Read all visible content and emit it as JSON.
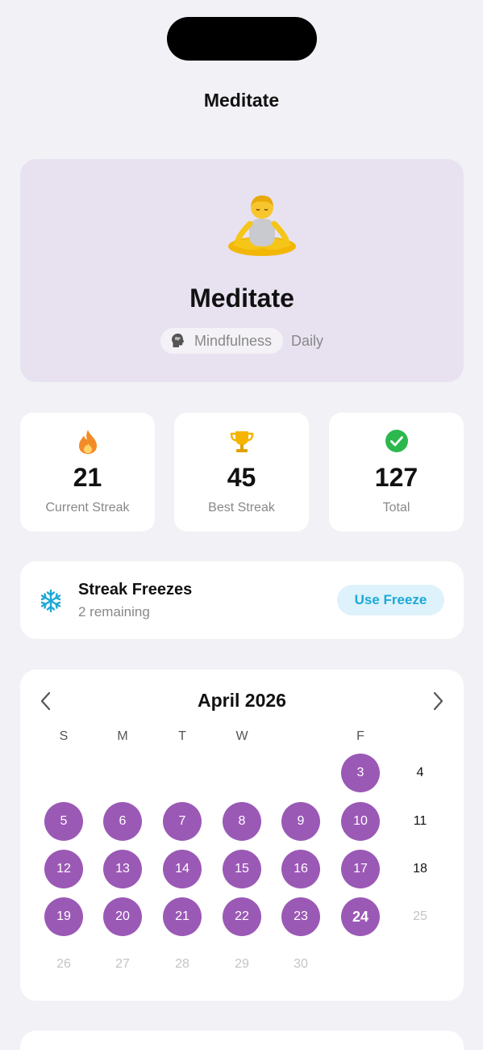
{
  "nav": {
    "title": "Meditate"
  },
  "habit": {
    "name": "Meditate",
    "category": "Mindfulness",
    "frequency": "Daily",
    "icon": "person-in-lotus-position-emoji",
    "card_color": "#E8E2F0"
  },
  "stats": [
    {
      "value": "21",
      "label": "Current Streak",
      "icon": "flame-icon"
    },
    {
      "value": "45",
      "label": "Best Streak",
      "icon": "trophy-icon"
    },
    {
      "value": "127",
      "label": "Total",
      "icon": "checkmark-circle-icon"
    }
  ],
  "freeze": {
    "title": "Streak Freezes",
    "subtitle": "2 remaining",
    "button": "Use Freeze",
    "icon": "snowflake-icon"
  },
  "calendar": {
    "title": "April 2026",
    "weekdays": [
      "S",
      "M",
      "T",
      "W",
      "",
      "F",
      ""
    ],
    "accent": "#9B59B6",
    "days": [
      {
        "d": "3",
        "state": "done"
      },
      {
        "d": "4",
        "state": "normal"
      },
      {
        "d": "5",
        "state": "done"
      },
      {
        "d": "6",
        "state": "done"
      },
      {
        "d": "7",
        "state": "done"
      },
      {
        "d": "8",
        "state": "done"
      },
      {
        "d": "9",
        "state": "done"
      },
      {
        "d": "10",
        "state": "done"
      },
      {
        "d": "11",
        "state": "normal"
      },
      {
        "d": "12",
        "state": "done"
      },
      {
        "d": "13",
        "state": "done"
      },
      {
        "d": "14",
        "state": "done"
      },
      {
        "d": "15",
        "state": "done"
      },
      {
        "d": "16",
        "state": "done"
      },
      {
        "d": "17",
        "state": "done"
      },
      {
        "d": "18",
        "state": "normal"
      },
      {
        "d": "19",
        "state": "done"
      },
      {
        "d": "20",
        "state": "done"
      },
      {
        "d": "21",
        "state": "done"
      },
      {
        "d": "22",
        "state": "done"
      },
      {
        "d": "23",
        "state": "done"
      },
      {
        "d": "24",
        "state": "today"
      },
      {
        "d": "25",
        "state": "future"
      },
      {
        "d": "26",
        "state": "future"
      },
      {
        "d": "27",
        "state": "future"
      },
      {
        "d": "28",
        "state": "future"
      },
      {
        "d": "29",
        "state": "future"
      },
      {
        "d": "30",
        "state": "future"
      }
    ]
  }
}
